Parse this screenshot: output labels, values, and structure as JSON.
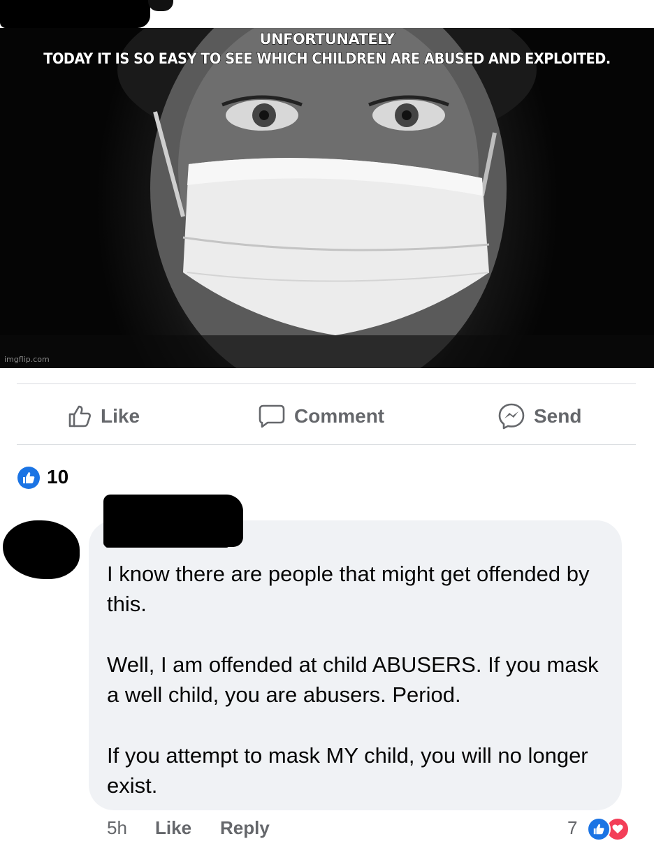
{
  "post": {
    "meme": {
      "caption_line1": "UNFORTUNATELY",
      "caption_line2": "TODAY IT IS SO EASY TO SEE WHICH CHILDREN ARE ABUSED AND EXPLOITED.",
      "watermark": "imgflip.com"
    },
    "actions": {
      "like_label": "Like",
      "comment_label": "Comment",
      "send_label": "Send"
    },
    "reactions": {
      "count": "10",
      "icon": "like-icon"
    }
  },
  "comment": {
    "paragraphs": [
      "I know there are people that might get offended by this.",
      "Well, I am offended at child ABUSERS.  If you mask a well child, you are abusers.   Period.",
      "If you attempt to mask MY child, you will no longer exist."
    ],
    "time": "5h",
    "like_label": "Like",
    "reply_label": "Reply",
    "reaction_count": "7",
    "reaction_icons": [
      "like-icon",
      "love-icon"
    ]
  },
  "colors": {
    "facebook_blue": "#1b74e4",
    "love_red": "#f33e58",
    "secondary_text": "#65676b",
    "bubble_bg": "#f0f2f5"
  }
}
